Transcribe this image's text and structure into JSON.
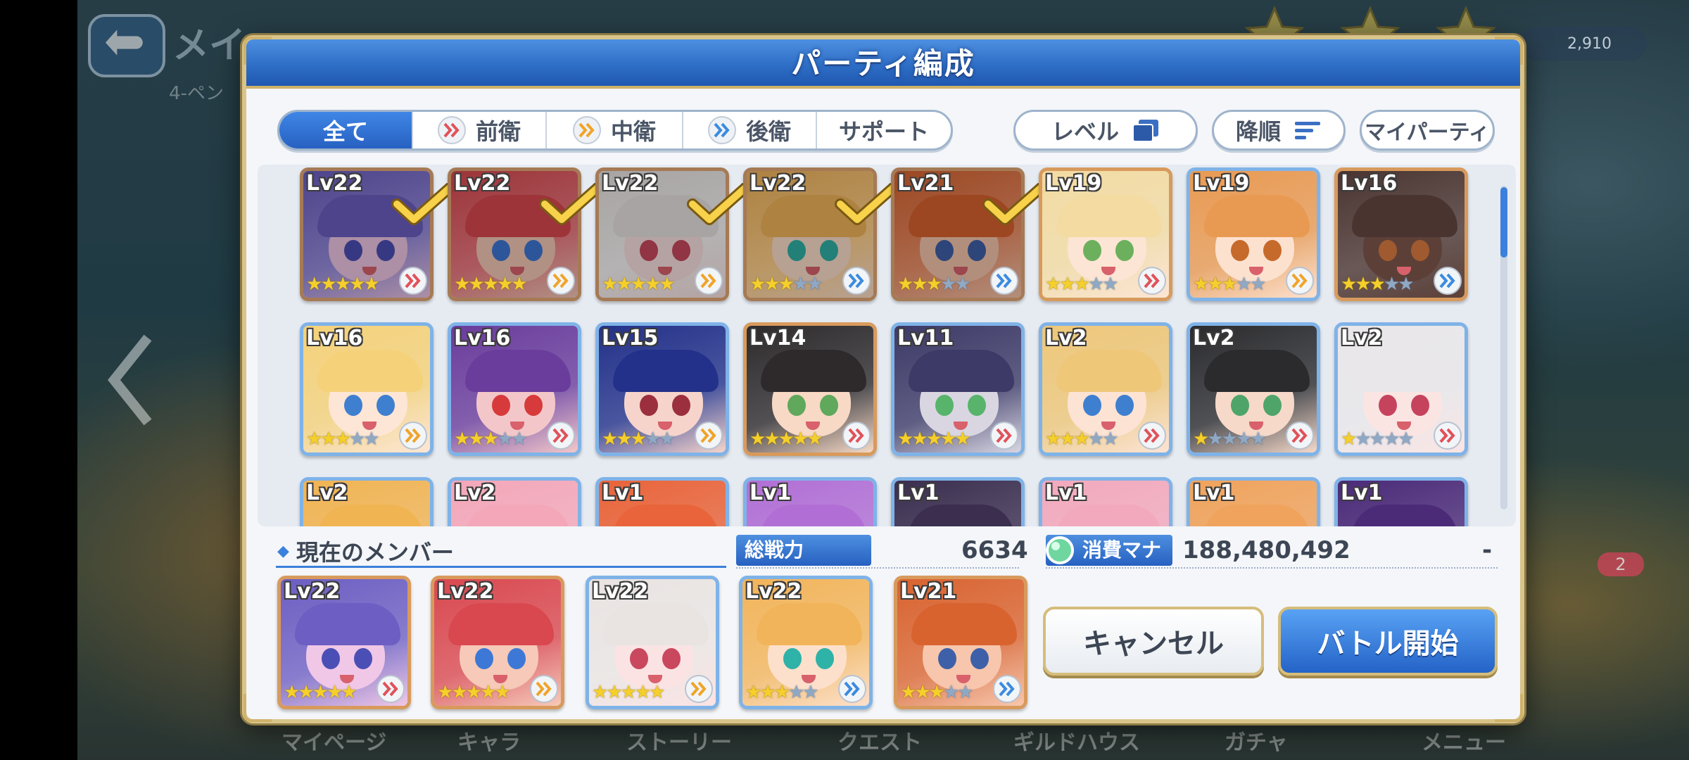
{
  "background": {
    "title_partial": "メイ",
    "sub_partial": "4-ペン",
    "gold": "2,910",
    "bottom_tabs": [
      "マイページ",
      "キャラ",
      "ストーリー",
      "クエスト",
      "ギルドハウス",
      "ガチャ",
      "メニュー"
    ],
    "badge": "2"
  },
  "dialog": {
    "title": "パーティ編成",
    "filter_tabs": [
      {
        "label": "全て",
        "active": true,
        "icon": null
      },
      {
        "label": "前衛",
        "active": false,
        "icon": "front-position-icon"
      },
      {
        "label": "中衛",
        "active": false,
        "icon": "middle-position-icon"
      },
      {
        "label": "後衛",
        "active": false,
        "icon": "rear-position-icon"
      },
      {
        "label": "サポート",
        "active": false,
        "icon": null
      }
    ],
    "sort_key": "レベル",
    "sort_order": "降順",
    "my_party": "マイパーティ",
    "characters": [
      {
        "level": "Lv22",
        "stars": 5,
        "selected": true,
        "position": "front",
        "palette": [
          "#6c5ec2",
          "#f0c7e6",
          "#4b4fb5"
        ]
      },
      {
        "level": "Lv22",
        "stars": 5,
        "selected": true,
        "position": "middle",
        "palette": [
          "#d9484f",
          "#f6c9b8",
          "#3e78d6"
        ]
      },
      {
        "level": "Lv22",
        "stars": 5,
        "selected": true,
        "position": "middle",
        "palette": [
          "#e9e4e2",
          "#fbe3e3",
          "#c9485e"
        ]
      },
      {
        "level": "Lv22",
        "stars": 3,
        "selected": true,
        "position": "rear",
        "palette": [
          "#f2b45a",
          "#fde0cb",
          "#2fb2a7"
        ]
      },
      {
        "level": "Lv21",
        "stars": 3,
        "selected": true,
        "position": "rear",
        "palette": [
          "#d9632f",
          "#f7c6ad",
          "#3e60a8"
        ]
      },
      {
        "level": "Lv19",
        "stars": 3,
        "selected": false,
        "position": "front",
        "palette": [
          "#f3dba2",
          "#fce5d4",
          "#6cb05d"
        ]
      },
      {
        "level": "Lv19",
        "stars": 3,
        "selected": false,
        "position": "middle",
        "palette": [
          "#e99a52",
          "#fde1cf",
          "#c66a2b"
        ]
      },
      {
        "level": "Lv16",
        "stars": 3,
        "selected": false,
        "position": "rear",
        "palette": [
          "#4a3430",
          "#5c4038",
          "#a05a30"
        ]
      },
      {
        "level": "Lv16",
        "stars": 3,
        "selected": false,
        "position": "middle",
        "palette": [
          "#f5d27a",
          "#fde6d5",
          "#3f7fd0"
        ]
      },
      {
        "level": "Lv16",
        "stars": 3,
        "selected": false,
        "position": "front",
        "palette": [
          "#6a3c9c",
          "#f3c7c9",
          "#d73a3a"
        ]
      },
      {
        "level": "Lv15",
        "stars": 3,
        "selected": false,
        "position": "middle",
        "palette": [
          "#23318a",
          "#f6d4cb",
          "#9b2f3d"
        ]
      },
      {
        "level": "Lv14",
        "stars": 5,
        "selected": false,
        "position": "front",
        "palette": [
          "#2e2a2c",
          "#f7d9c5",
          "#5fa85c"
        ]
      },
      {
        "level": "Lv11",
        "stars": 5,
        "selected": false,
        "position": "front",
        "palette": [
          "#3d3a67",
          "#d9d6e2",
          "#58b46a"
        ]
      },
      {
        "level": "Lv2",
        "stars": 3,
        "selected": false,
        "position": "front",
        "palette": [
          "#eec779",
          "#fce3d3",
          "#3f7fd0"
        ]
      },
      {
        "level": "Lv2",
        "stars": 1,
        "selected": false,
        "position": "front",
        "palette": [
          "#2b2b2e",
          "#f6d9c9",
          "#4fa46a"
        ]
      },
      {
        "level": "Lv2",
        "stars": 1,
        "selected": false,
        "position": "front",
        "palette": [
          "#e9e7ea",
          "#fbe5e3",
          "#c6435e"
        ]
      },
      {
        "level": "Lv2",
        "stars": 0,
        "selected": false,
        "position": "",
        "palette": [
          "#f1b453",
          "#fde1cf",
          "#3f7fd0"
        ]
      },
      {
        "level": "Lv2",
        "stars": 0,
        "selected": false,
        "position": "",
        "palette": [
          "#f4a7b9",
          "#fde4d8",
          "#3f7fd0"
        ]
      },
      {
        "level": "Lv1",
        "stars": 0,
        "selected": false,
        "position": "",
        "palette": [
          "#e9643a",
          "#fde0cf",
          "#3f7fd0"
        ]
      },
      {
        "level": "Lv1",
        "stars": 0,
        "selected": false,
        "position": "",
        "palette": [
          "#b16fd5",
          "#f3d5e8",
          "#3f7fd0"
        ]
      },
      {
        "level": "Lv1",
        "stars": 0,
        "selected": false,
        "position": "",
        "palette": [
          "#3b2e4f",
          "#d7cfe0",
          "#3f7fd0"
        ]
      },
      {
        "level": "Lv1",
        "stars": 0,
        "selected": false,
        "position": "",
        "palette": [
          "#f3a9bd",
          "#fde4d8",
          "#3f7fd0"
        ]
      },
      {
        "level": "Lv1",
        "stars": 0,
        "selected": false,
        "position": "",
        "palette": [
          "#f0a35c",
          "#fde1cf",
          "#3f7fd0"
        ]
      },
      {
        "level": "Lv1",
        "stars": 0,
        "selected": false,
        "position": "",
        "palette": [
          "#4b2a78",
          "#d6c9e6",
          "#3f7fd0"
        ]
      }
    ],
    "current_members_label": "現在のメンバー",
    "total_power_label": "総戦力",
    "total_power_value": "6634",
    "mana_label": "消費マナ",
    "mana_value": "188,480,492",
    "mana_extra": "-",
    "members": [
      {
        "level": "Lv22",
        "stars": 5,
        "position": "front",
        "palette": [
          "#6c5ec2",
          "#f0c7e6",
          "#4b4fb5"
        ]
      },
      {
        "level": "Lv22",
        "stars": 5,
        "position": "middle",
        "palette": [
          "#d9484f",
          "#f6c9b8",
          "#3e78d6"
        ]
      },
      {
        "level": "Lv22",
        "stars": 5,
        "position": "middle",
        "palette": [
          "#e9e4e2",
          "#fbe3e3",
          "#c9485e"
        ]
      },
      {
        "level": "Lv22",
        "stars": 3,
        "position": "rear",
        "palette": [
          "#f2b45a",
          "#fde0cb",
          "#2fb2a7"
        ]
      },
      {
        "level": "Lv21",
        "stars": 3,
        "position": "rear",
        "palette": [
          "#d9632f",
          "#f7c6ad",
          "#3e60a8"
        ]
      }
    ],
    "cancel_label": "キャンセル",
    "start_label": "バトル開始"
  },
  "colors": {
    "accent_blue": "#2f6fc7",
    "gold_frame": "#d5bd7b",
    "front_icon": "#e0525a",
    "middle_icon": "#f0a42a",
    "rear_icon": "#3b8be0",
    "star_on": "#f5cf2a",
    "star_off": "#8fa8c4"
  }
}
